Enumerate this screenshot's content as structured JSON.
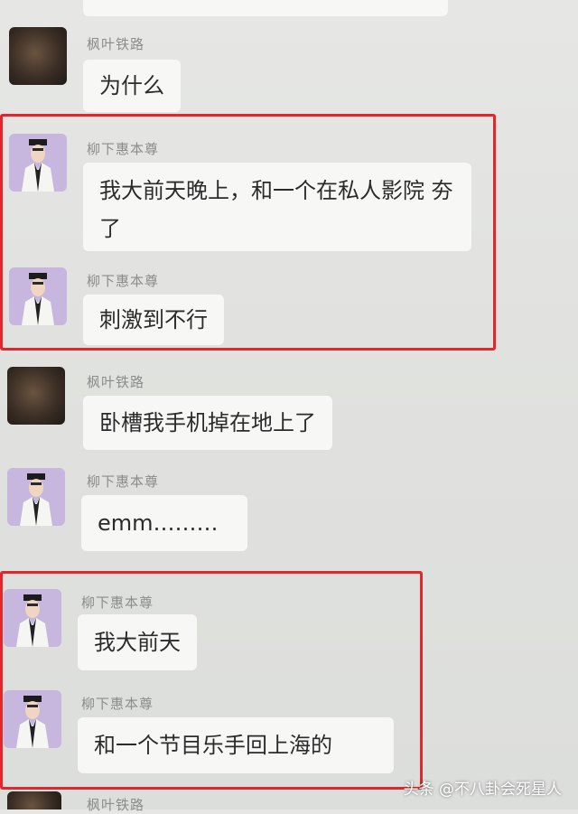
{
  "messages": [
    {
      "sender": "枫叶铁路",
      "text": "为什么"
    },
    {
      "sender": "柳下惠本尊",
      "text": "我大前天晚上，和一个在私人影院 夯了"
    },
    {
      "sender": "柳下惠本尊",
      "text": "刺激到不行"
    },
    {
      "sender": "枫叶铁路",
      "text": "卧槽我手机掉在地上了"
    },
    {
      "sender": "柳下惠本尊",
      "text": "emm………"
    },
    {
      "sender": "柳下惠本尊",
      "text": "我大前天"
    },
    {
      "sender": "柳下惠本尊",
      "text": "和一个节目乐手回上海的"
    },
    {
      "sender": "枫叶铁路",
      "text": ""
    }
  ],
  "avatars": {
    "user_a": "blurred-dark-avatar",
    "user_b": "cartoon-character-avatar"
  },
  "colors": {
    "highlight_border": "#e2262b",
    "bubble": "#f7f7f5",
    "avatar_purple": "#c7b7de"
  },
  "watermark": "头条 @不八卦会死星人"
}
